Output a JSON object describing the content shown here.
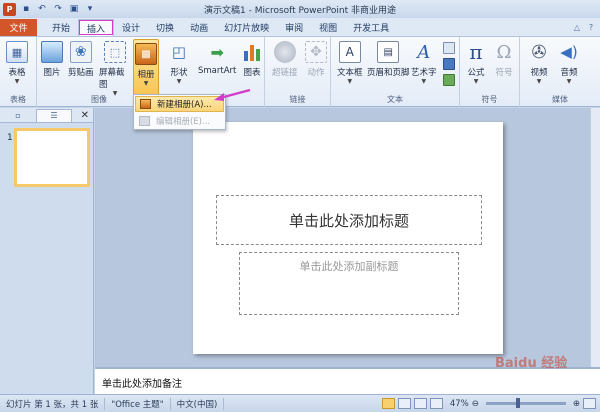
{
  "window": {
    "title": "演示文稿1 - Microsoft PowerPoint 非商业用途"
  },
  "tabs": [
    {
      "label": "文件",
      "kind": "file"
    },
    {
      "label": "开始",
      "kind": "normal"
    },
    {
      "label": "插入",
      "kind": "active"
    },
    {
      "label": "设计",
      "kind": "normal"
    },
    {
      "label": "切换",
      "kind": "normal"
    },
    {
      "label": "动画",
      "kind": "normal"
    },
    {
      "label": "幻灯片放映",
      "kind": "normal"
    },
    {
      "label": "审阅",
      "kind": "normal"
    },
    {
      "label": "视图",
      "kind": "normal"
    },
    {
      "label": "开发工具",
      "kind": "normal"
    }
  ],
  "ribbon": {
    "groups": {
      "table": "表格",
      "image": "图像",
      "link": "链接",
      "text": "文本",
      "symbol": "符号",
      "media": "媒体"
    },
    "buttons": {
      "table": "表格",
      "picture": "图片",
      "clipart": "剪贴画",
      "screenshot": "屏幕截图",
      "album": "相册",
      "shapes": "形状",
      "smartart": "SmartArt",
      "chart": "图表",
      "hyperlink": "超链接",
      "action": "动作",
      "textbox": "文本框",
      "header_footer": "页眉和页脚",
      "wordart": "艺术字",
      "equation": "公式",
      "symbol": "符号",
      "video": "视频",
      "audio": "音频"
    }
  },
  "album_menu": {
    "new_album": "新建相册(A)...",
    "edit_album": "编辑相册(E)..."
  },
  "slide_panel": {
    "slide_number": "1"
  },
  "slide": {
    "title_placeholder": "单击此处添加标题",
    "subtitle_placeholder": "单击此处添加副标题"
  },
  "notes": {
    "placeholder": "单击此处添加备注"
  },
  "status": {
    "slide_info": "幻灯片 第 1 张，共 1 张",
    "theme": "\"Office 主题\"",
    "language": "中文(中国)",
    "zoom": "47%"
  },
  "watermark": "Baidu 经验",
  "colors": {
    "file_tab": "#d3562a",
    "highlight": "#f8c44f",
    "arrow": "#d23cc8"
  }
}
